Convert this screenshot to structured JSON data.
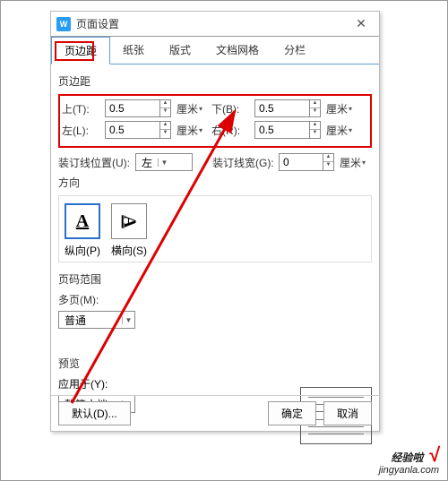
{
  "dialog": {
    "title": "页面设置",
    "app_glyph": "W"
  },
  "tabs": {
    "items": [
      {
        "label": "页边距"
      },
      {
        "label": "纸张"
      },
      {
        "label": "版式"
      },
      {
        "label": "文档网格"
      },
      {
        "label": "分栏"
      }
    ]
  },
  "margins": {
    "group_label": "页边距",
    "top_label": "上(T):",
    "top_value": "0.5",
    "bottom_label": "下(B):",
    "bottom_value": "0.5",
    "left_label": "左(L):",
    "left_value": "0.5",
    "right_label": "右(R):",
    "right_value": "0.5",
    "unit": "厘米"
  },
  "gutter": {
    "pos_label": "装订线位置(U):",
    "pos_value": "左",
    "width_label": "装订线宽(G):",
    "width_value": "0",
    "unit": "厘米"
  },
  "orientation": {
    "group_label": "方向",
    "portrait": "纵向(P)",
    "landscape": "横向(S)",
    "glyph": "A"
  },
  "pages": {
    "group_label": "页码范围",
    "multi_label": "多页(M):",
    "multi_value": "普通"
  },
  "preview": {
    "group_label": "预览",
    "apply_label": "应用于(Y):",
    "apply_value": "整篇文档"
  },
  "buttons": {
    "default": "默认(D)...",
    "ok": "确定",
    "cancel": "取消"
  },
  "watermark": {
    "main": "经验啦",
    "check": "√",
    "sub": "jingyanla.com"
  }
}
